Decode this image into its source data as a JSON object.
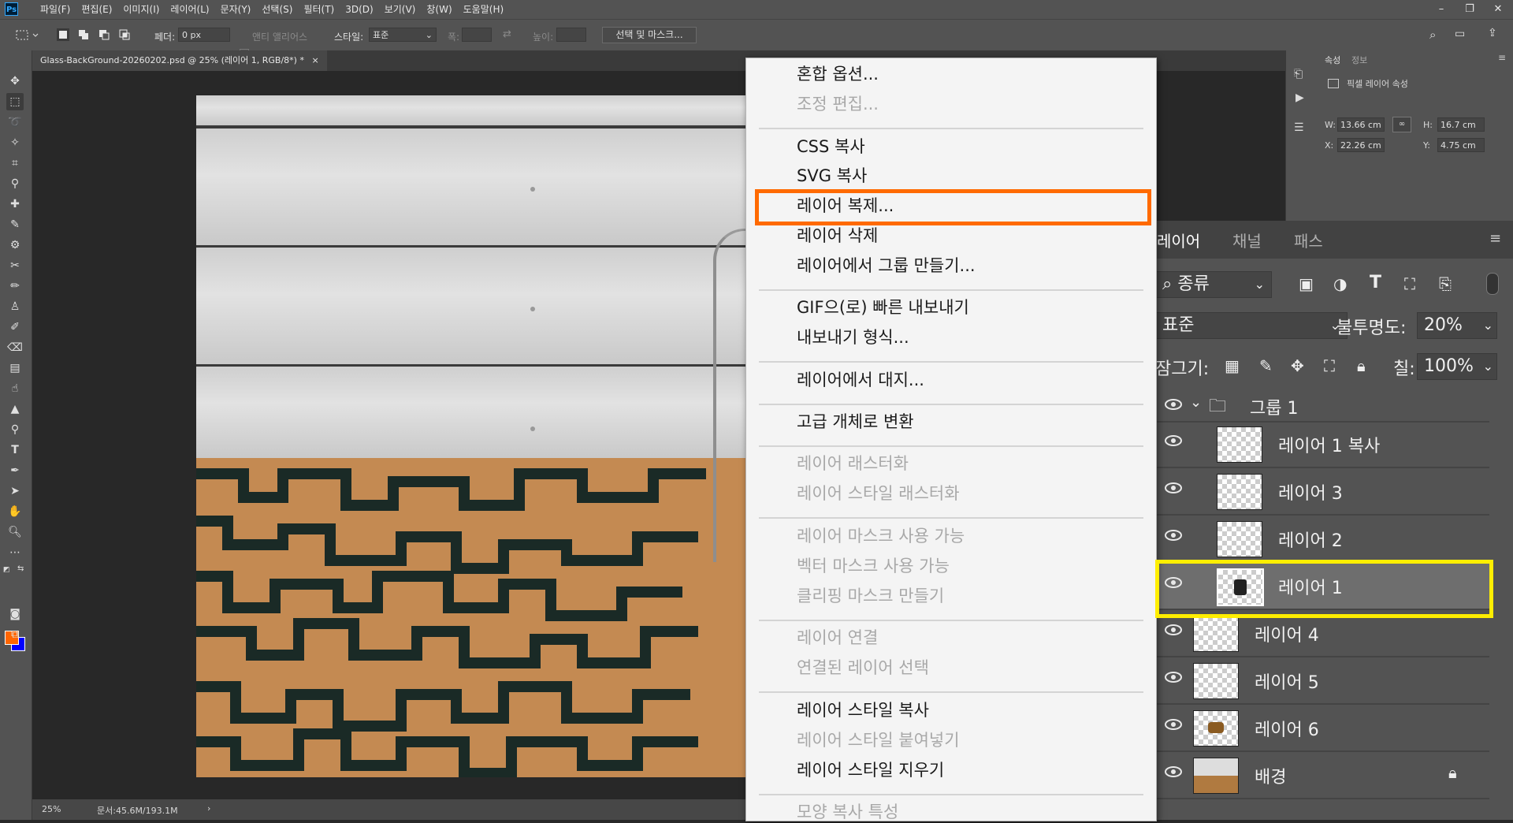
{
  "app": {
    "logo": "Ps"
  },
  "menubar": {
    "items": [
      "파일(F)",
      "편집(E)",
      "이미지(I)",
      "레이어(L)",
      "문자(Y)",
      "선택(S)",
      "필터(T)",
      "3D(D)",
      "보기(V)",
      "창(W)",
      "도움말(H)"
    ]
  },
  "optbar": {
    "feather_label": "페더:",
    "feather_value": "0 px",
    "antialias_label": "앤티 앨리어스",
    "style_label": "스타일:",
    "style_value": "표준",
    "width_label": "폭:",
    "height_label": "높이:",
    "select_mask_button": "선택 및 마스크..."
  },
  "document": {
    "tab_title": "Glass-BackGround-20260202.psd @ 25% (레이어 1, RGB/8*) *",
    "close_glyph": "×"
  },
  "status": {
    "zoom": "25%",
    "doc_size": "문서:45.6M/193.1M",
    "arrow": "›"
  },
  "context_menu": {
    "items": [
      {
        "label": "혼합 옵션...",
        "enabled": true
      },
      {
        "label": "조정 편집...",
        "enabled": false
      },
      {
        "label": "CSS 복사",
        "enabled": true
      },
      {
        "label": "SVG 복사",
        "enabled": true
      },
      {
        "label": "레이어 복제...",
        "enabled": true,
        "highlighted": true
      },
      {
        "label": "레이어 삭제",
        "enabled": true
      },
      {
        "label": "레이어에서 그룹 만들기...",
        "enabled": true
      },
      {
        "label": "GIF으(로) 빠른 내보내기",
        "enabled": true
      },
      {
        "label": "내보내기 형식...",
        "enabled": true
      },
      {
        "label": "레이어에서 대지...",
        "enabled": true
      },
      {
        "label": "고급 개체로 변환",
        "enabled": true
      },
      {
        "label": "레이어 래스터화",
        "enabled": false
      },
      {
        "label": "레이어 스타일 래스터화",
        "enabled": false
      },
      {
        "label": "레이어 마스크 사용 가능",
        "enabled": false
      },
      {
        "label": "벡터 마스크 사용 가능",
        "enabled": false
      },
      {
        "label": "클리핑 마스크 만들기",
        "enabled": false
      },
      {
        "label": "레이어 연결",
        "enabled": false
      },
      {
        "label": "연결된 레이어 선택",
        "enabled": false
      },
      {
        "label": "레이어 스타일 복사",
        "enabled": true
      },
      {
        "label": "레이어 스타일 붙여넣기",
        "enabled": false
      },
      {
        "label": "레이어 스타일 지우기",
        "enabled": true
      },
      {
        "label": "모양 복사 특성",
        "enabled": false
      }
    ]
  },
  "properties_panel": {
    "tabs": [
      "속성",
      "정보"
    ],
    "header": "픽셀 레이어 속성",
    "w_label": "W:",
    "w_value": "13.66 cm",
    "h_label": "H:",
    "h_value": "16.7 cm",
    "x_label": "X:",
    "x_value": "22.26 cm",
    "y_label": "Y:",
    "y_value": "4.75 cm",
    "link_icon": "link-icon"
  },
  "layers_panel": {
    "tabs": [
      "레이어",
      "채널",
      "패스"
    ],
    "filter_value": "종류",
    "blend_mode": "표준",
    "opacity_label": "불투명도:",
    "opacity_value": "20%",
    "lock_label": "잠그기:",
    "fill_label": "칠:",
    "fill_value": "100%",
    "layers": [
      {
        "name": "그룹 1",
        "type": "group"
      },
      {
        "name": "레이어 1 복사",
        "type": "layer",
        "indent": true
      },
      {
        "name": "레이어 3",
        "type": "layer",
        "indent": true
      },
      {
        "name": "레이어 2",
        "type": "layer",
        "indent": true
      },
      {
        "name": "레이어 1",
        "type": "layer",
        "indent": true,
        "selected": true
      },
      {
        "name": "레이어 4",
        "type": "layer"
      },
      {
        "name": "레이어 5",
        "type": "layer"
      },
      {
        "name": "레이어 6",
        "type": "layer"
      },
      {
        "name": "배경",
        "type": "background",
        "locked": true
      }
    ]
  },
  "colors": {
    "highlight_orange": "#ff6a00",
    "highlight_yellow": "#ffee00",
    "foreground": "#ff6600",
    "background": "#0000ff"
  }
}
